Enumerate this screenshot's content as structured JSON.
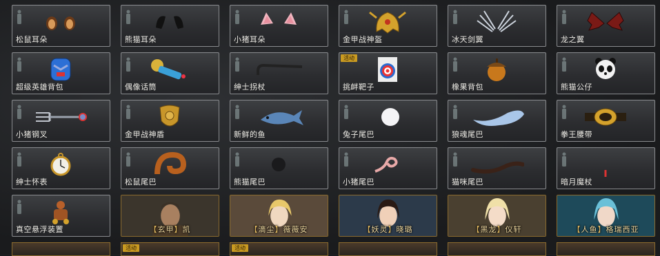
{
  "items": [
    {
      "label": "松鼠耳朵",
      "icon": "squirrel-ears-icon"
    },
    {
      "label": "熊猫耳朵",
      "icon": "panda-ears-icon"
    },
    {
      "label": "小猪耳朵",
      "icon": "pig-ears-icon"
    },
    {
      "label": "金甲战神盔",
      "icon": "golden-helmet-icon"
    },
    {
      "label": "冰天剑翼",
      "icon": "ice-sword-wings-icon"
    },
    {
      "label": "龙之翼",
      "icon": "dragon-wings-icon"
    },
    {
      "label": "超级英雄背包",
      "icon": "superhero-backpack-icon"
    },
    {
      "label": "偶像话筒",
      "icon": "idol-microphone-icon"
    },
    {
      "label": "绅士拐杖",
      "icon": "gentleman-cane-icon"
    },
    {
      "label": "挑衅靶子",
      "icon": "target-icon",
      "badge": "活动"
    },
    {
      "label": "橡果背包",
      "icon": "acorn-backpack-icon"
    },
    {
      "label": "熊猫公仔",
      "icon": "panda-doll-icon"
    },
    {
      "label": "小猪钢叉",
      "icon": "pig-fork-icon"
    },
    {
      "label": "金甲战神盾",
      "icon": "golden-shield-icon"
    },
    {
      "label": "新鲜的鱼",
      "icon": "fish-icon"
    },
    {
      "label": "兔子尾巴",
      "icon": "rabbit-tail-icon"
    },
    {
      "label": "狼魂尾巴",
      "icon": "wolf-tail-icon"
    },
    {
      "label": "拳王腰带",
      "icon": "champion-belt-icon"
    },
    {
      "label": "绅士怀表",
      "icon": "pocket-watch-icon"
    },
    {
      "label": "松鼠尾巴",
      "icon": "squirrel-tail-icon"
    },
    {
      "label": "熊猫尾巴",
      "icon": "panda-tail-icon"
    },
    {
      "label": "小猪尾巴",
      "icon": "pig-tail-icon"
    },
    {
      "label": "猫咪尾巴",
      "icon": "cat-tail-icon"
    },
    {
      "label": "暗月魔杖",
      "icon": "dark-moon-wand-icon"
    },
    {
      "label": "真空悬浮装置",
      "icon": "vacuum-hover-device-icon"
    }
  ],
  "characters": [
    {
      "tag": "玄甲",
      "name": "凯"
    },
    {
      "tag": "滴尘",
      "name": "薇薇安"
    },
    {
      "tag": "妖灵",
      "name": "晓璐"
    },
    {
      "tag": "黑龙",
      "name": "仪轩"
    },
    {
      "tag": "人鱼",
      "name": "格瑞西亚"
    }
  ],
  "bottom_badges": [
    "活动",
    "活动"
  ],
  "colors": {
    "accent_gold": "#c99a21",
    "card_border": "#8a8c8f",
    "char_border": "#8b6b2e"
  }
}
